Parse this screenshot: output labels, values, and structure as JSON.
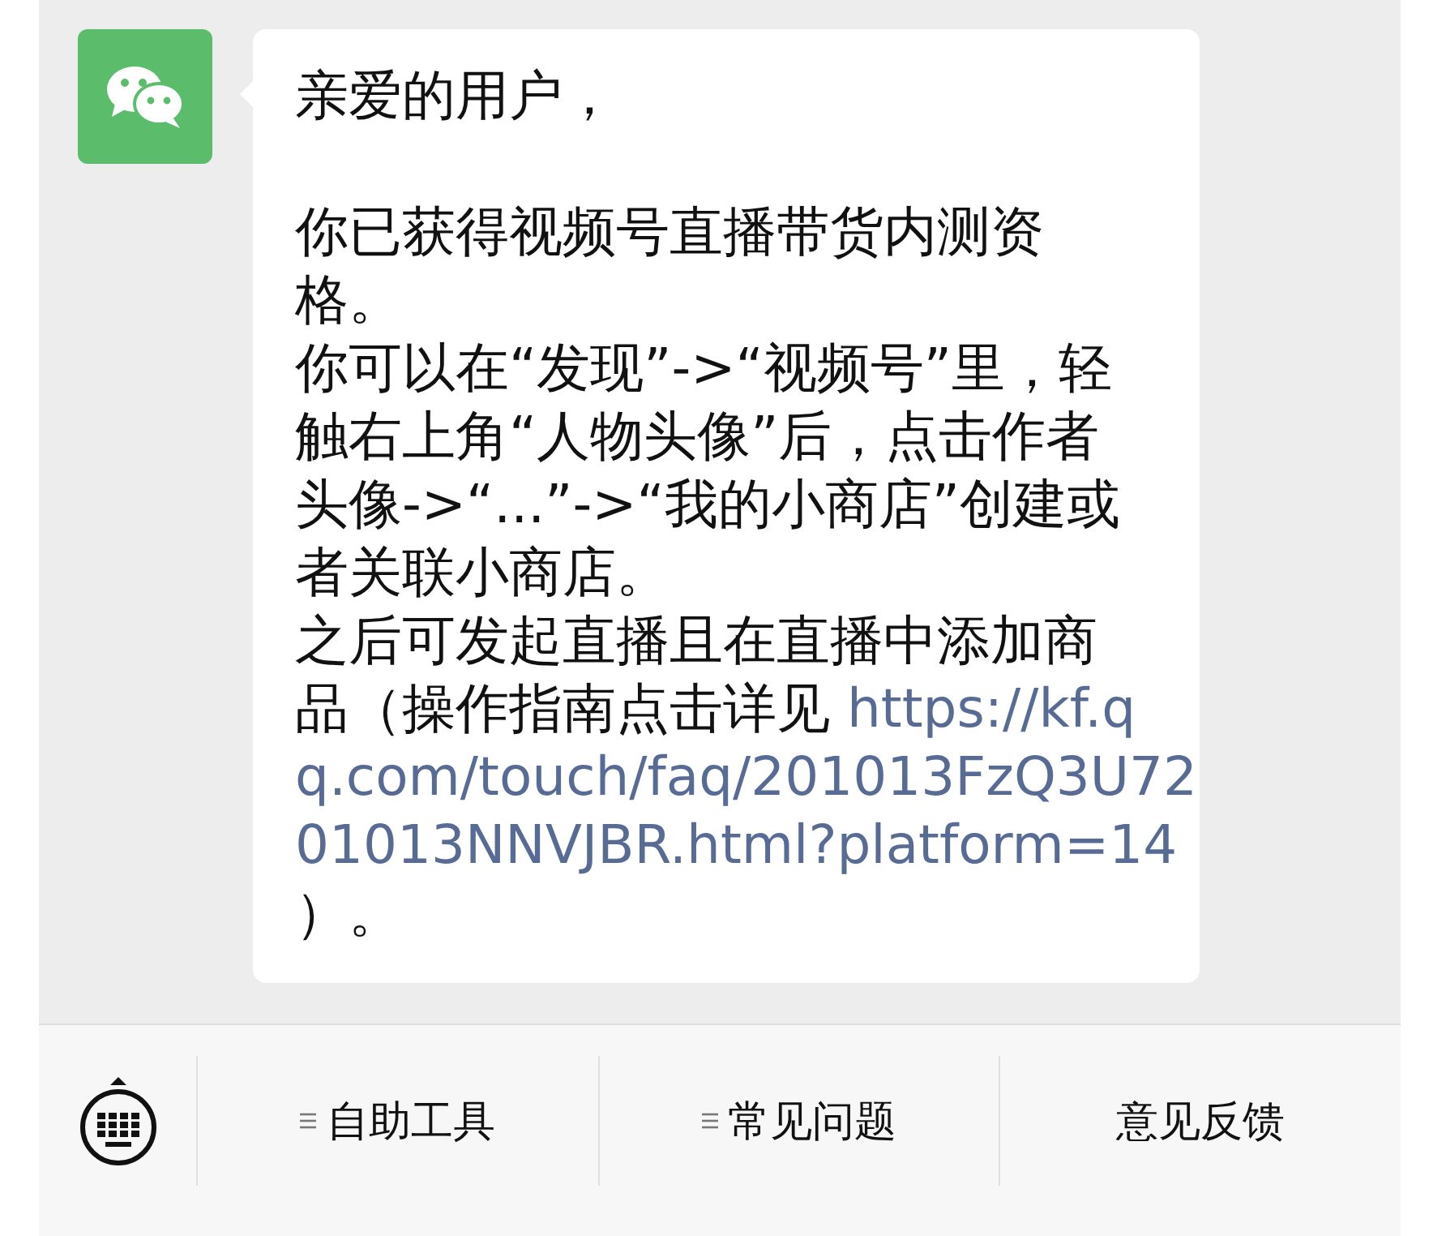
{
  "message": {
    "greeting": "亲爱的用户，",
    "lines": [
      {
        "text": "你已获得视频号直播带货内测资"
      },
      {
        "text": "格。"
      },
      {
        "text": "你可以在“发现”->“视频号”里，轻"
      },
      {
        "text": "触右上角“人物头像”后，点击作者"
      },
      {
        "text": "头像->“...”->“我的小商店”创建或"
      },
      {
        "text": "者关联小商店。"
      },
      {
        "text": "之后可发起直播且在直播中添加商"
      },
      {
        "text": "品（操作指南点击详见 ",
        "link": "https://kf.q"
      },
      {
        "link": "q.com/touch/faq/201013FzQ3U72"
      },
      {
        "link": "01013NNVJBR.html?platform=14"
      },
      {
        "text": "）。"
      }
    ]
  },
  "menu": [
    {
      "label": "自助工具",
      "submenu": true
    },
    {
      "label": "常见问题",
      "submenu": true
    },
    {
      "label": "意见反馈",
      "submenu": false
    }
  ]
}
